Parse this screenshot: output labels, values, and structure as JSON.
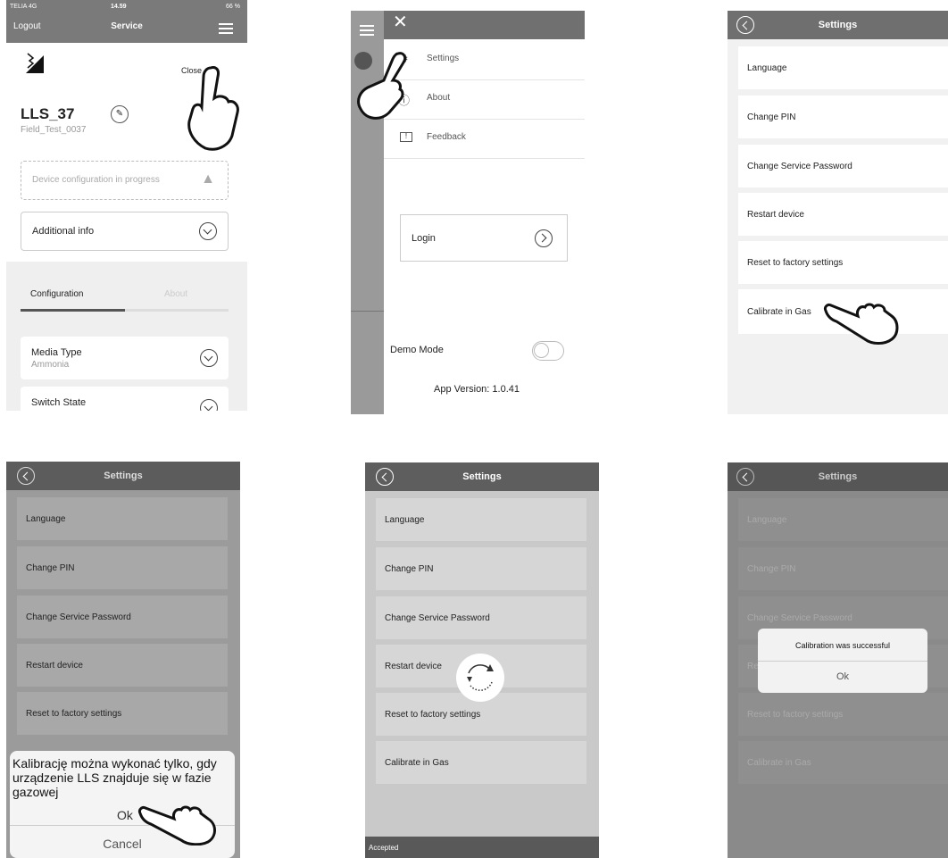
{
  "s1": {
    "status": {
      "carrier": "TELIA 4G",
      "time": "14.59",
      "battery": "66 %"
    },
    "header": {
      "left": "Logout",
      "title": "Service"
    },
    "close_label": "Close",
    "device_name": "LLS_37",
    "device_sub": "Field_Test_0037",
    "config_banner": "Device configuration in progress",
    "additional_info": "Additional info",
    "tabs": [
      "Configuration",
      "About"
    ],
    "media_type_label": "Media Type",
    "media_type_value": "Ammonia",
    "switch_state_label": "Switch State"
  },
  "s2": {
    "menu": [
      "Settings",
      "About",
      "Feedback"
    ],
    "login": "Login",
    "demo_mode": "Demo Mode",
    "app_version": "App Version: 1.0.41"
  },
  "settings": {
    "title": "Settings",
    "items": [
      "Language",
      "Change PIN",
      "Change Service Password",
      "Restart device",
      "Reset to factory settings",
      "Calibrate in Gas"
    ]
  },
  "s4": {
    "dialog_text": "Kalibrację można wykonać tylko, gdy urządzenie LLS znajduje się w fazie gazowej",
    "ok": "Ok",
    "cancel": "Cancel"
  },
  "s5": {
    "toast": "Accepted"
  },
  "s6": {
    "dialog_text": "Calibration was successful",
    "ok": "Ok"
  },
  "colors": {
    "header": "#6f6f6f",
    "toggle_off": "#ffffff",
    "overlay": "rgba(0,0,0,0.35)"
  }
}
